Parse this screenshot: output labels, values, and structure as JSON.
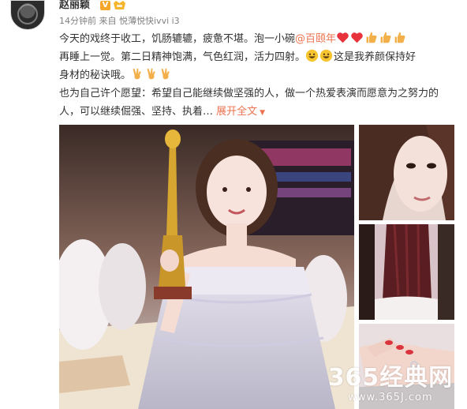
{
  "user": {
    "name": "赵丽颖",
    "vip_badge": "V",
    "avatar_icon": "avatar-photo"
  },
  "meta": {
    "time": "14分钟前",
    "source_prefix": "来自",
    "source": "悦薄悦快ivvi i3"
  },
  "post": {
    "line1_text": "今天的戏终于收工，饥肠辘辘，疲惫不堪。泡一小碗",
    "mention": "@百颐年",
    "line2_text_a": "再睡上一觉。第二日精神饱满，气色红润，活力四射。",
    "line2_text_b": "这是我养颜保持好",
    "line3_text": "身材的秘诀哦。",
    "para2_text": "也为自己许个愿望：希望自己能继续做坚强的人，做一个热爱表演而愿意为之努力的人，可以继续倔强、坚持、执着…",
    "expand_label": "展开全文",
    "emojis": [
      "heart-icon",
      "heart-icon",
      "thumbs-up-icon",
      "thumbs-up-icon",
      "thumbs-up-icon",
      "grin-icon",
      "grin-icon",
      "victory-hand-icon",
      "victory-hand-icon",
      "victory-hand-icon"
    ]
  },
  "colors": {
    "link": "#eb7350",
    "text": "#333333",
    "meta": "#808080",
    "heart": "#e8323c",
    "thumb": "#f3b04a"
  },
  "watermark": {
    "line1": "365经典网",
    "line2": "www.365J.com"
  }
}
